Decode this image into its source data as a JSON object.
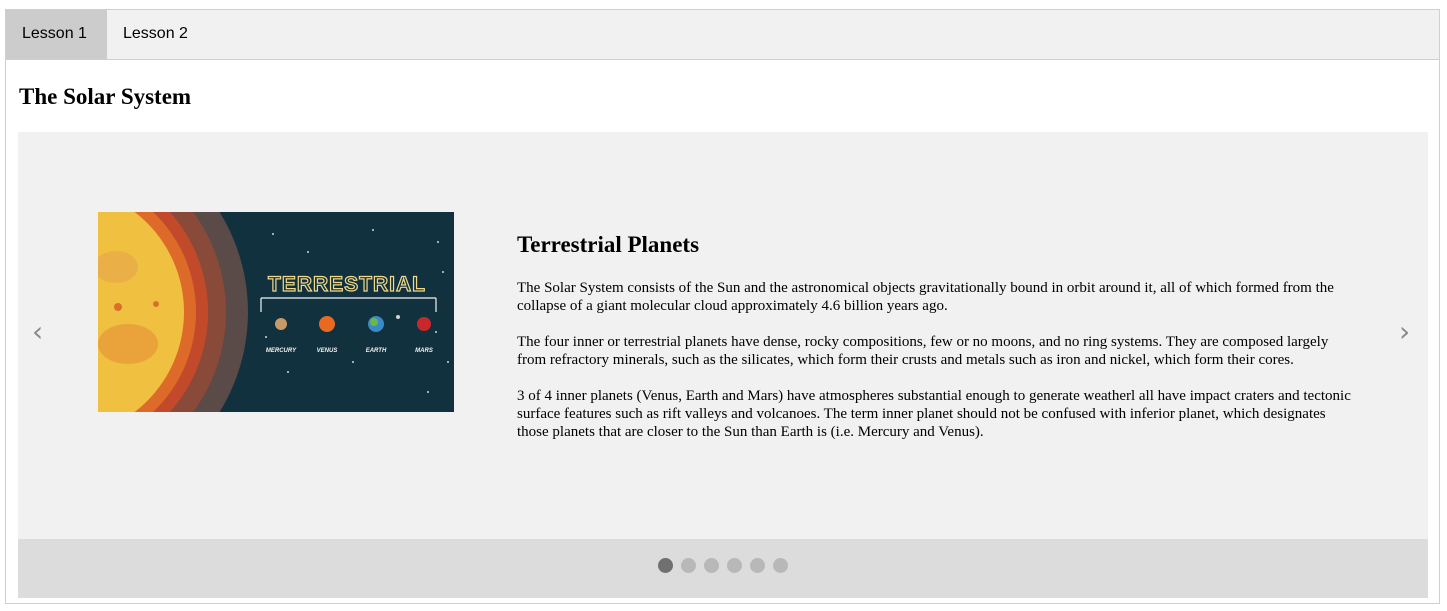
{
  "tabs": [
    {
      "label": "Lesson 1",
      "active": true
    },
    {
      "label": "Lesson 2",
      "active": false
    }
  ],
  "page_title": "The Solar System",
  "slider": {
    "prev_arrow": "‹",
    "next_arrow": "›",
    "slide": {
      "title": "Terrestrial Planets",
      "image": {
        "banner": "TERRESTRIAL",
        "planets": [
          "MERCURY",
          "VENUS",
          "EARTH",
          "MARS"
        ]
      },
      "paragraphs": [
        "The Solar System consists of the Sun and the astronomical objects gravitationally bound in orbit around it, all of which formed from the collapse of a giant molecular cloud approximately 4.6 billion years ago.",
        "The four inner or terrestrial planets have dense, rocky compositions, few or no moons, and no ring systems. They are composed largely from refractory minerals, such as the silicates, which form their crusts and metals such as iron and nickel, which form their cores.",
        "3 of 4 inner planets (Venus, Earth and Mars) have atmospheres substantial enough to generate weatherl all have impact craters and tectonic surface features such as rift valleys and volcanoes. The term inner planet should not be confused with inferior planet, which designates those planets that are closer to the Sun than Earth is (i.e. Mercury and Venus)."
      ]
    },
    "dots": {
      "count": 6,
      "active_index": 0
    }
  },
  "colors": {
    "tab_active": "#cccccc",
    "tab_bar": "#f1f1f1",
    "slider_bg": "#f1f1f1",
    "dot_bar": "#dcdcdc",
    "dot_active": "#707070",
    "dot_inactive": "#b8b8b8",
    "image_bg": "#12313f"
  }
}
